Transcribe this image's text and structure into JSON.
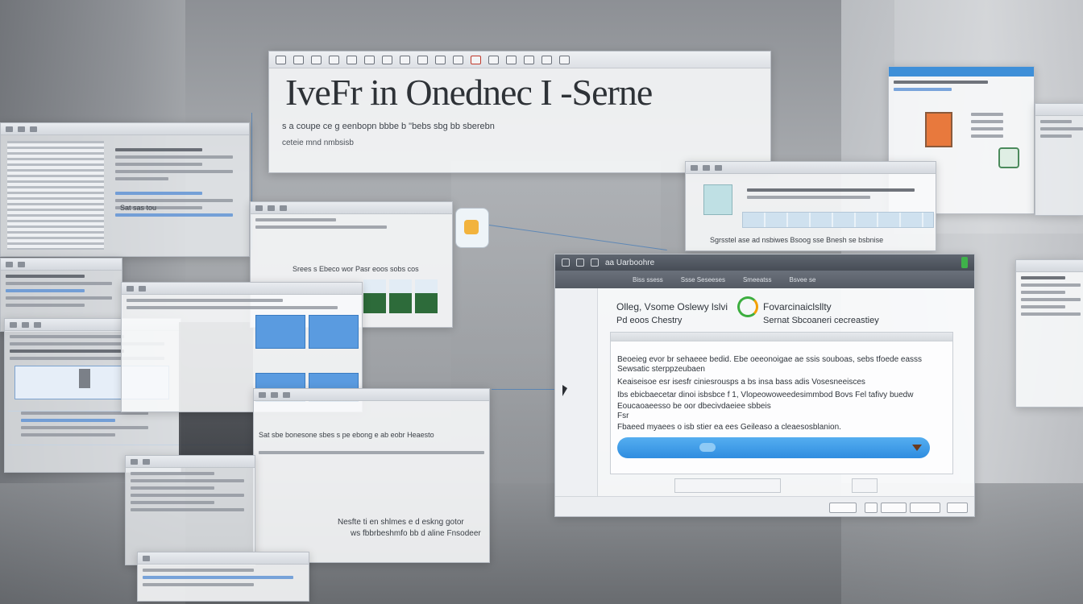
{
  "main_window": {
    "heading": "IveFr in Onednec I -Serne",
    "subline": "s a coupe ce g eenbopn bbbe b \"bebs sbg bb sberebn",
    "subline2": "ceteie mnd nmbsisb"
  },
  "left_panels": {
    "panel_a_label": "Sat sas tou",
    "panel_b_heading": "Srees s Ebeco wor Pasr eoos sobs cos",
    "panel_c_text": "Sat sbe bonesone sbes s pe ebong e ab eobr Heaesto",
    "panel_d_text_1": "Nesfte ti en shlmes e d eskng gotor",
    "panel_d_text_2": "ws fbbrbeshmfo bb d aline Fnsodeer"
  },
  "top_mid_right": {
    "caption": "Sgrsstel ase ad nsbiwes Bsoog sse Bnesh se bsbnise"
  },
  "dialog": {
    "title": "aa Uarboohre",
    "menu": [
      "Biss ssess",
      "Ssse Seseeses",
      "Smeeatss",
      "Bsvee se"
    ],
    "heading_left_1": "Olleg, Vsome Oslewy lslvi",
    "heading_left_2": "Pd eoos Chestry",
    "heading_right_1": "Fovarcinaiclsllty",
    "heading_right_2": "Sernat Sbcoaneri cecreastiey",
    "rows": [
      "Beoeieg evor br sehaeee bedid. Ebe oeeonoigae ae ssis souboas, sebs tfoede easss",
      "Sewsatic sterppzeubaen",
      "Keaiseisoe esr isesfr ciniesrousps a bs insa bass adis Vosesneeisces",
      "Ibs ebicbaecetar dinoi isbsbce f 1, Vlopeowoweedesimmbod Bovs Fel tafivy buedw",
      "Eoucaoaeesso be oor dbecivdaeiee sbbeis",
      "Fsr",
      "Fbaeed myaees o isb stier ea ees Geileaso a cleaesosblanion."
    ]
  }
}
